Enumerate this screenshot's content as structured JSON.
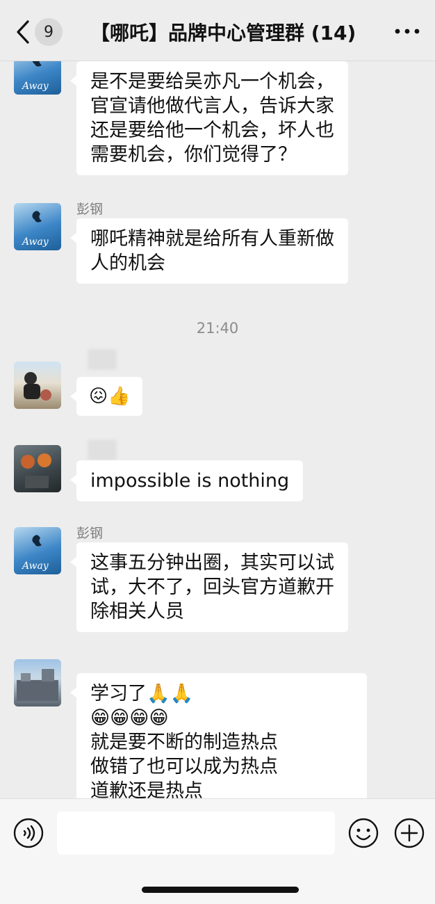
{
  "header": {
    "back_count": "9",
    "title": "【哪吒】品牌中心管理群 (14)"
  },
  "messages": [
    {
      "sender": "",
      "lines": [
        "是不是要给吴亦凡一个机会，",
        "官宣请他做代言人，告诉大家",
        "还是要给他一个机会，坏人也",
        "需要机会，你们觉得了？"
      ]
    },
    {
      "sender": "彭钢",
      "lines": [
        "哪吒精神就是给所有人重新做",
        "人的机会"
      ]
    },
    {
      "sender": "",
      "emojis": [
        "😖",
        "👍"
      ]
    },
    {
      "sender": "",
      "lines": [
        "impossible is nothing"
      ]
    },
    {
      "sender": "彭钢",
      "lines": [
        "这事五分钟出圈，其实可以试",
        "试，大不了，回头官方道歉开",
        "除相关人员"
      ]
    },
    {
      "sender": "",
      "lines": [
        "学习了🙏🙏",
        "😁😁😁😁",
        "就是要不断的制造热点",
        "做错了也可以成为热点",
        "道歉还是热点"
      ]
    }
  ],
  "timestamp": "21:40",
  "avatar_text": "Away",
  "icons": {
    "back": "chevron-left-icon",
    "more": "more-icon",
    "voice": "voice-icon",
    "emoji": "emoji-icon",
    "plus": "plus-icon"
  }
}
